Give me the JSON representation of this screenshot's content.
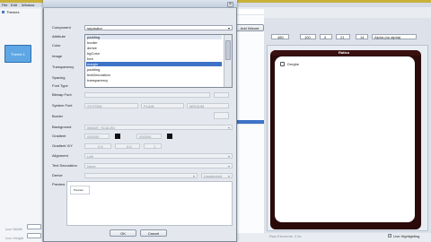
{
  "app": {
    "menu": [
      "File",
      "Edit",
      "Window"
    ],
    "left_tab": "Themes",
    "left_button": "Theme 1",
    "icon_width_label": "Icon Width",
    "icon_height_label": "Icon Height",
    "toolbar_button": "Add Wizard",
    "device_combo": "Touch Device",
    "style_combo": "Unsel",
    "right_combo": "Name",
    "spin_1": "480",
    "spin_2": "100",
    "spin_3": "0",
    "spin_4": "21",
    "spin_5": "14",
    "right_combo2": "Alpha (no alpha)",
    "phone_title": "Ratico",
    "phone_item": "Dreghe",
    "status_text": "Raw Elements: 3 kb",
    "live_highlighting_label": "Live Highlighting",
    "live_highlighting_checked": true
  },
  "dialog": {
    "close_icon": "close-icon",
    "labels": {
      "component": "Component",
      "attribute": "Attribute",
      "color": "Color",
      "image": "Image",
      "transparency": "Transparency",
      "spacing": "Spacing",
      "font_type": "Font Type",
      "bitmap_font": "Bitmap Font",
      "system_font": "System Font",
      "border": "Border",
      "background": "Background",
      "gradient": "Gradient",
      "gradient_xy": "Gradient X/Y",
      "alignment": "Alignment",
      "text_decoration": "Text Decoration",
      "derive": "Derive",
      "preview": "Preview"
    },
    "values": {
      "component": "separator",
      "attribute": "padding",
      "system_font_1": "SYSTEM",
      "system_font_2": "PLAIN",
      "system_font_3": "MEDIUM",
      "background": "IMAGE_SCALED",
      "gradient_1": "000000",
      "gradient_2": "000000",
      "gradient_x": "0.5",
      "gradient_y": "0.5",
      "gradient_z": "1",
      "alignment": "Left",
      "text_decoration": "None",
      "derive_right": "Unselected",
      "preview_text": "Preview"
    },
    "attribute_options": [
      "padding",
      "border",
      "derive",
      "bgColor",
      "font",
      "margin",
      "padding",
      "textDecoration",
      "transparency"
    ],
    "attribute_selected_index": 5,
    "ok_label": "OK",
    "cancel_label": "Cancel"
  }
}
